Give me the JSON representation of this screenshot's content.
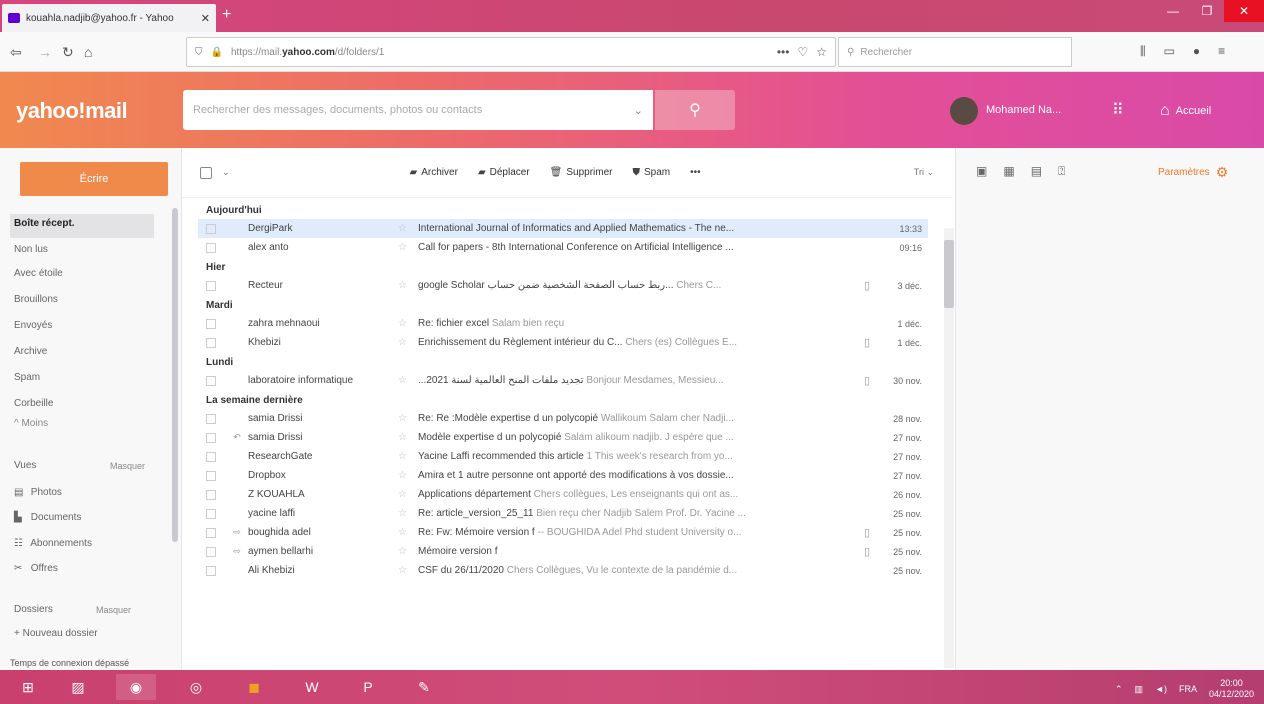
{
  "browser": {
    "tab_title": "kouahla.nadjib@yahoo.fr - Yahoo",
    "url_plain": "https://mail.",
    "url_bold": "yahoo.com",
    "url_rest": "/d/folders/1",
    "search_placeholder": "Rechercher"
  },
  "header": {
    "logo": "yahoo!mail",
    "search_placeholder": "Rechercher des messages, documents, photos ou contacts",
    "user_name": "Mohamed Na...",
    "home_label": "Accueil"
  },
  "sidebar": {
    "compose_label": "Écrire",
    "folders": [
      {
        "label": "Boîte récept.",
        "active": true
      },
      {
        "label": "Non lus",
        "active": false
      },
      {
        "label": "Avec étoile",
        "active": false
      },
      {
        "label": "Brouillons",
        "active": false
      },
      {
        "label": "Envoyés",
        "active": false
      },
      {
        "label": "Archive",
        "active": false
      },
      {
        "label": "Spam",
        "active": false
      },
      {
        "label": "Corbeille",
        "active": false
      }
    ],
    "less_label": "^ Moins",
    "views_label": "Vues",
    "hide_label": "Masquer",
    "views": [
      "Photos",
      "Documents",
      "Abonnements",
      "Offres"
    ],
    "dossiers_label": "Dossiers",
    "dossiers_hide": "Masquer",
    "new_folder": "+ Nouveau dossier",
    "status": "Temps de connexion dépassé"
  },
  "toolbar": {
    "archive": "Archiver",
    "move": "Déplacer",
    "delete": "Supprimer",
    "spam": "Spam",
    "more": "•••",
    "sort": "Tri"
  },
  "right_pane": {
    "settings": "Paramètres"
  },
  "groups": [
    {
      "label": "Aujourd'hui",
      "rows": [
        {
          "from": "DergiPark",
          "subject": "International Journal of Informatics and Applied Mathematics - The ne...",
          "preview": "",
          "date": "13:33",
          "selected": true,
          "attach": false,
          "thread": ""
        },
        {
          "from": "alex anto",
          "subject": "Call for papers - 8th International Conference on Artificial Intelligence ...",
          "preview": "",
          "date": "09:16",
          "selected": false,
          "attach": false,
          "thread": ""
        }
      ]
    },
    {
      "label": "Hier",
      "rows": [
        {
          "from": "Recteur",
          "subject": "google Scholar ربط حساب الصفحة الشخصية ضمن حساب...",
          "preview": "Chers C...",
          "date": "3 déc.",
          "selected": false,
          "attach": true,
          "thread": ""
        }
      ]
    },
    {
      "label": "Mardi",
      "rows": [
        {
          "from": "zahra mehnaoui",
          "subject": "Re: fichier excel",
          "preview": "Salam bien reçu",
          "date": "1 déc.",
          "selected": false,
          "attach": false,
          "thread": ""
        },
        {
          "from": "Khebizi",
          "subject": "Enrichissement du Règlement intérieur du C...",
          "preview": "Chers (es) Collègues E...",
          "date": "1 déc.",
          "selected": false,
          "attach": true,
          "thread": ""
        }
      ]
    },
    {
      "label": "Lundi",
      "rows": [
        {
          "from": "laboratoire informatique",
          "subject": "...تجديد ملفات المنح العالمية لسنة 2021",
          "preview": "Bonjour Mesdames, Messieu...",
          "date": "30 nov.",
          "selected": false,
          "attach": true,
          "thread": ""
        }
      ]
    },
    {
      "label": "La semaine dernière",
      "rows": [
        {
          "from": "samia Drissi",
          "subject": "Re: Re :Modèle expertise d un polycopié",
          "preview": "Wallikoum Salam cher Nadji...",
          "date": "28 nov.",
          "selected": false,
          "attach": false,
          "thread": ""
        },
        {
          "from": "samia Drissi",
          "subject": "Modèle expertise d un polycopié",
          "preview": "Salam alikoum nadjib. J espère que ...",
          "date": "27 nov.",
          "selected": false,
          "attach": false,
          "thread": "↶"
        },
        {
          "from": "ResearchGate",
          "subject": "Yacine Laffi recommended this article",
          "preview": "1 This week's research from yo...",
          "date": "27 nov.",
          "selected": false,
          "attach": false,
          "thread": ""
        },
        {
          "from": "Dropbox",
          "subject": "Amira et 1 autre personne ont apporté des modifications à vos dossie...",
          "preview": "",
          "date": "27 nov.",
          "selected": false,
          "attach": false,
          "thread": ""
        },
        {
          "from": "Z KOUAHLA",
          "subject": "Applications département",
          "preview": "Chers collègues, Les enseignants qui ont as...",
          "date": "26 nov.",
          "selected": false,
          "attach": false,
          "thread": ""
        },
        {
          "from": "yacine laffi",
          "subject": "Re: article_version_25_11",
          "preview": "Bien reçu cher Nadjib Salem Prof. Dr. Yacine ...",
          "date": "25 nov.",
          "selected": false,
          "attach": false,
          "thread": ""
        },
        {
          "from": "boughida adel",
          "subject": "Re: Fw: Mémoire version f",
          "preview": "-- BOUGHIDA Adel Phd student University o...",
          "date": "25 nov.",
          "selected": false,
          "attach": true,
          "thread": "⇨"
        },
        {
          "from": "aymen bellarhi",
          "subject": "Mémoire version f",
          "preview": "",
          "date": "25 nov.",
          "selected": false,
          "attach": true,
          "thread": "⇨"
        },
        {
          "from": "Ali Khebizi",
          "subject": "CSF du 26/11/2020",
          "preview": "Chers Collègues, Vu le contexte de la pandémie d...",
          "date": "25 nov.",
          "selected": false,
          "attach": false,
          "thread": ""
        }
      ]
    }
  ],
  "taskbar": {
    "lang": "FRA",
    "time": "20:00",
    "date": "04/12/2020"
  },
  "colors": {
    "compose": "#f08a4b",
    "accent": "#6001d2",
    "settings": "#f0782a"
  }
}
